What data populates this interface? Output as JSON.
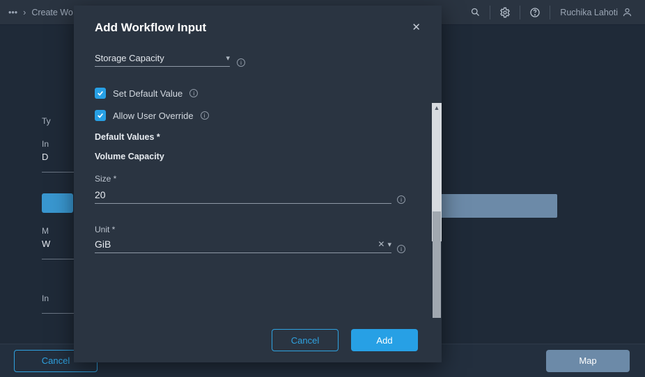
{
  "topbar": {
    "breadcrumb_prefix": "•••",
    "breadcrumb_sep": "›",
    "breadcrumb_current": "Create Wo",
    "user_name": "Ruchika Lahoti"
  },
  "background": {
    "left_labels": {
      "t": "Ty",
      "i": "In",
      "d": "D",
      "m": "M",
      "w": "W",
      "i2": "In"
    },
    "footer_cancel": "Cancel",
    "footer_map": "Map"
  },
  "modal": {
    "title": "Add Workflow Input",
    "type_select": {
      "value": "Storage Capacity"
    },
    "set_default_label": "Set Default Value",
    "set_default_checked": true,
    "allow_override_label": "Allow User Override",
    "allow_override_checked": true,
    "default_values_heading": "Default Values *",
    "volume_capacity_heading": "Volume Capacity",
    "size": {
      "label": "Size *",
      "value": "20"
    },
    "unit": {
      "label": "Unit *",
      "value": "GiB"
    },
    "buttons": {
      "cancel": "Cancel",
      "add": "Add"
    }
  }
}
